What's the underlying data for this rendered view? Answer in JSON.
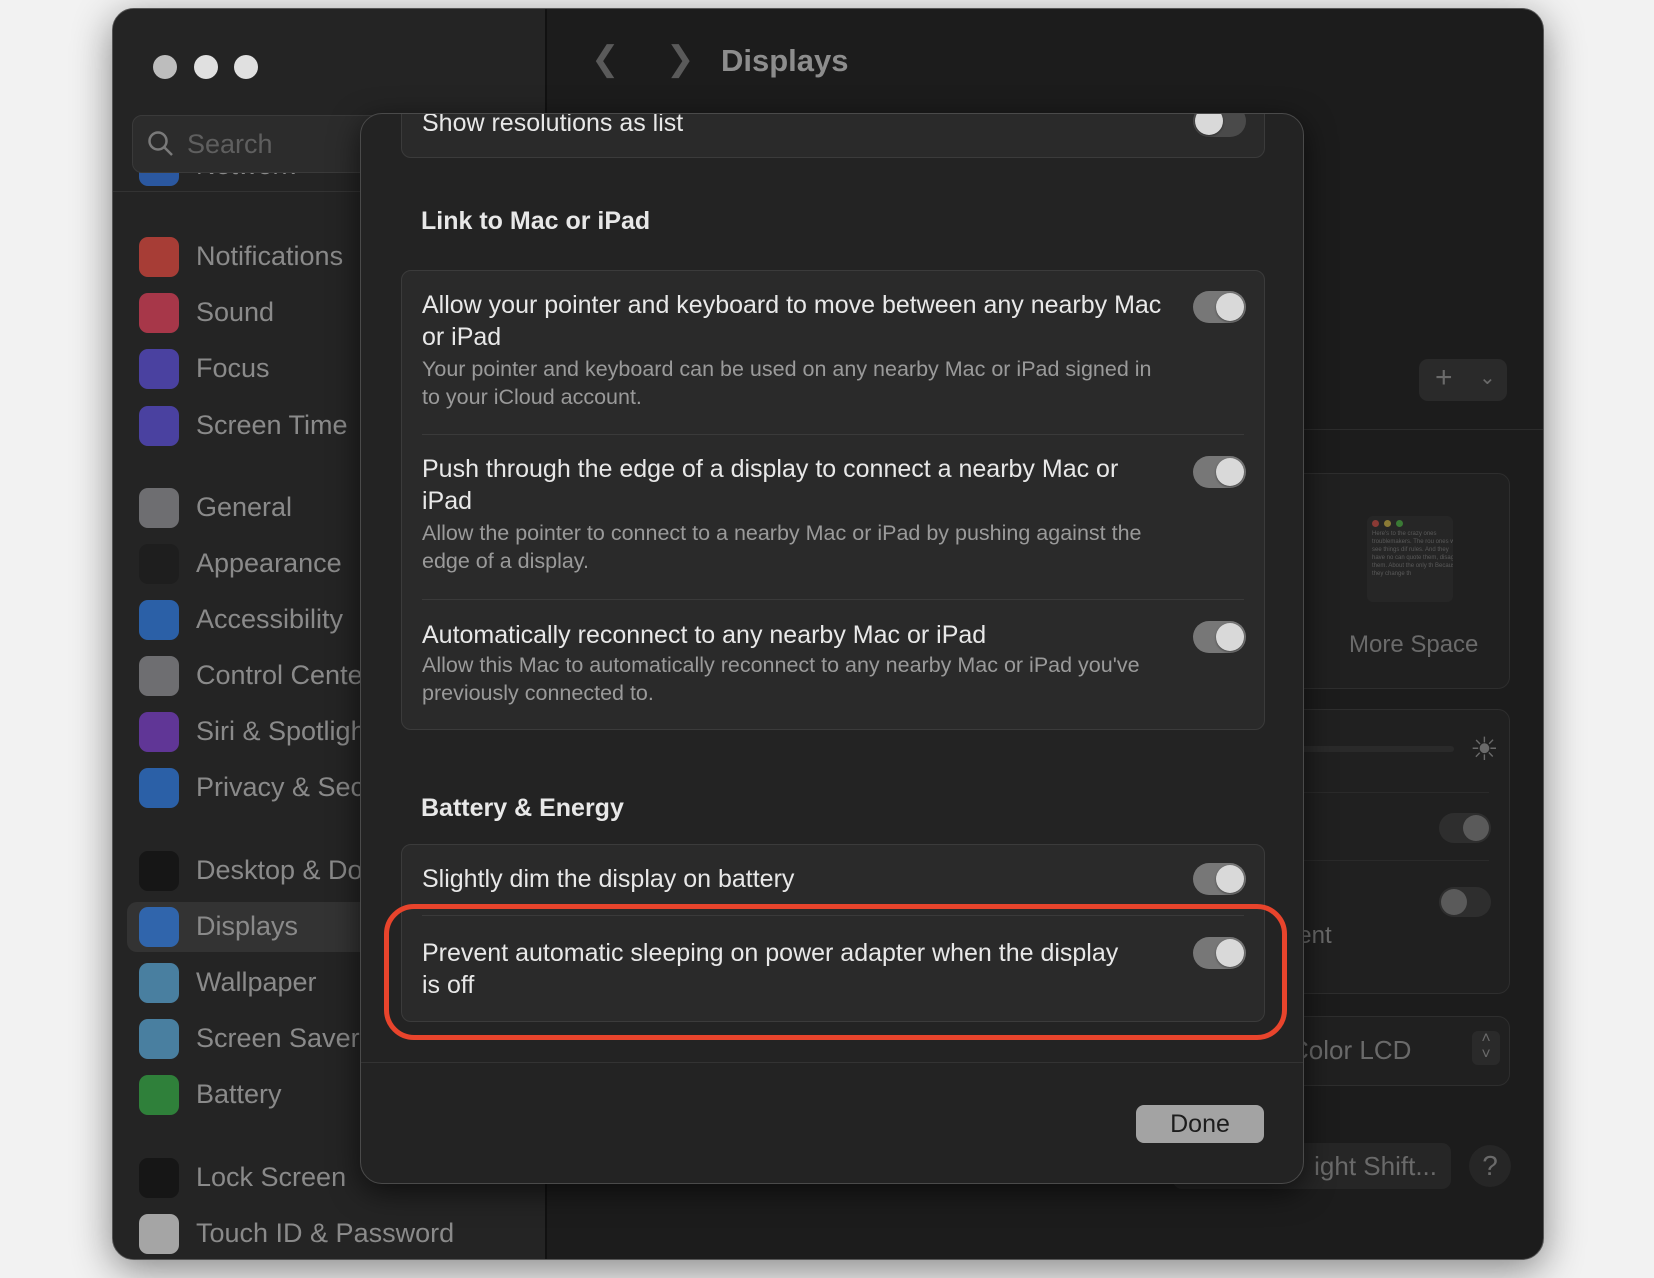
{
  "window": {
    "title": "Displays"
  },
  "sidebar": {
    "search_placeholder": "Search",
    "items": [
      {
        "label": "Network",
        "icon": "globe-icon",
        "color": "#2f6fd6"
      },
      {
        "label": "Notifications",
        "icon": "bell-icon",
        "color": "#e0483e"
      },
      {
        "label": "Sound",
        "icon": "speaker-icon",
        "color": "#e0405a"
      },
      {
        "label": "Focus",
        "icon": "moon-icon",
        "color": "#5b4fd6"
      },
      {
        "label": "Screen Time",
        "icon": "hourglass-icon",
        "color": "#5b4fd6"
      },
      {
        "label": "General",
        "icon": "gear-icon",
        "color": "#8e8e93"
      },
      {
        "label": "Appearance",
        "icon": "appearance-icon",
        "color": "#1c1c1c"
      },
      {
        "label": "Accessibility",
        "icon": "accessibility-icon",
        "color": "#2f7be0"
      },
      {
        "label": "Control Center",
        "icon": "switches-icon",
        "color": "#8e8e93"
      },
      {
        "label": "Siri & Spotlight",
        "icon": "siri-icon",
        "color": "#7a3ec8"
      },
      {
        "label": "Privacy & Security",
        "icon": "hand-icon",
        "color": "#2f7be0"
      },
      {
        "label": "Desktop & Dock",
        "icon": "dock-icon",
        "color": "#111111"
      },
      {
        "label": "Displays",
        "icon": "sun-icon",
        "color": "#2f7be0",
        "selected": true
      },
      {
        "label": "Wallpaper",
        "icon": "flower-icon",
        "color": "#5aa7d6"
      },
      {
        "label": "Screen Saver",
        "icon": "screensaver-icon",
        "color": "#5aa7d6"
      },
      {
        "label": "Battery",
        "icon": "battery-icon",
        "color": "#34a845"
      },
      {
        "label": "Lock Screen",
        "icon": "lock-icon",
        "color": "#111111"
      },
      {
        "label": "Touch ID & Password",
        "icon": "fingerprint-icon",
        "color": "#dddddd"
      }
    ]
  },
  "background": {
    "more_space_label": "More Space",
    "thumbnail_text": "Here's to the crazy ones troublemakers. The rou ones who see things dif rules. And they have no can quote them, disagre them. About the only th Because they change th",
    "partial_label": "fferent",
    "display_select": "Color LCD",
    "night_shift_button": "ight Shift...",
    "help_button": "?",
    "add_button": "+",
    "toggle_on": true,
    "toggle_off": false
  },
  "dialog": {
    "top_row": {
      "title": "Show resolutions as list",
      "on": false
    },
    "link_section": {
      "heading": "Link to Mac or iPad",
      "rows": [
        {
          "title": "Allow your pointer and keyboard to move between any nearby Mac or iPad",
          "subtitle": "Your pointer and keyboard can be used on any nearby Mac or iPad signed in to your iCloud account.",
          "on": true
        },
        {
          "title": "Push through the edge of a display to connect a nearby Mac or iPad",
          "subtitle": "Allow the pointer to connect to a nearby Mac or iPad by pushing against the edge of a display.",
          "on": true
        },
        {
          "title": "Automatically reconnect to any nearby Mac or iPad",
          "subtitle": "Allow this Mac to automatically reconnect to any nearby Mac or iPad you've previously connected to.",
          "on": true
        }
      ]
    },
    "battery_section": {
      "heading": "Battery & Energy",
      "rows": [
        {
          "title": "Slightly dim the display on battery",
          "on": true
        },
        {
          "title": "Prevent automatic sleeping on power adapter when the display is off",
          "on": true
        }
      ]
    },
    "done_label": "Done"
  },
  "colors": {
    "highlight": "#e8442c",
    "toggle_track": "#777777",
    "dialog_bg": "#232323"
  }
}
